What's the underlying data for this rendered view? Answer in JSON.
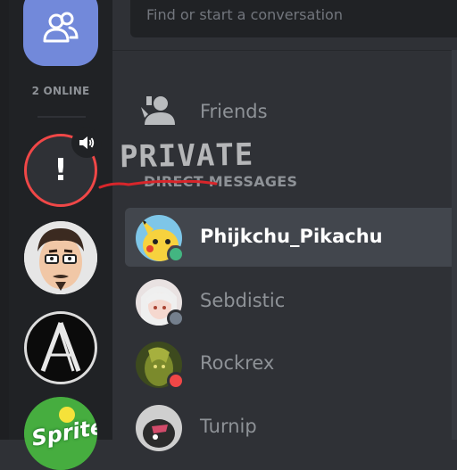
{
  "rail": {
    "online_count": "2 ONLINE",
    "servers": [
      {
        "icon": "alert-icon",
        "glyph": "!",
        "has_voice": true
      },
      {
        "icon": "cartoon-face-avatar"
      },
      {
        "icon": "letter-a-logo"
      },
      {
        "icon": "sprite-logo",
        "text": "Sprite"
      }
    ]
  },
  "search": {
    "placeholder": "Find or start a conversation"
  },
  "nav": {
    "friends_label": "Friends"
  },
  "dm": {
    "section_header": "DIRECT MESSAGES",
    "annotation": "PRIVATE",
    "items": [
      {
        "name": "Phijkchu_Pikachu",
        "status": "online",
        "selected": true
      },
      {
        "name": "Sebdistic",
        "status": "offline",
        "selected": false
      },
      {
        "name": "Rockrex",
        "status": "dnd",
        "selected": false
      },
      {
        "name": "Turnip",
        "status": "offline",
        "selected": false
      }
    ]
  },
  "colors": {
    "accent": "#7289da",
    "online": "#43b581",
    "dnd": "#f04747",
    "offline": "#747f8d",
    "background": "#2f3136",
    "rail": "#202225"
  }
}
